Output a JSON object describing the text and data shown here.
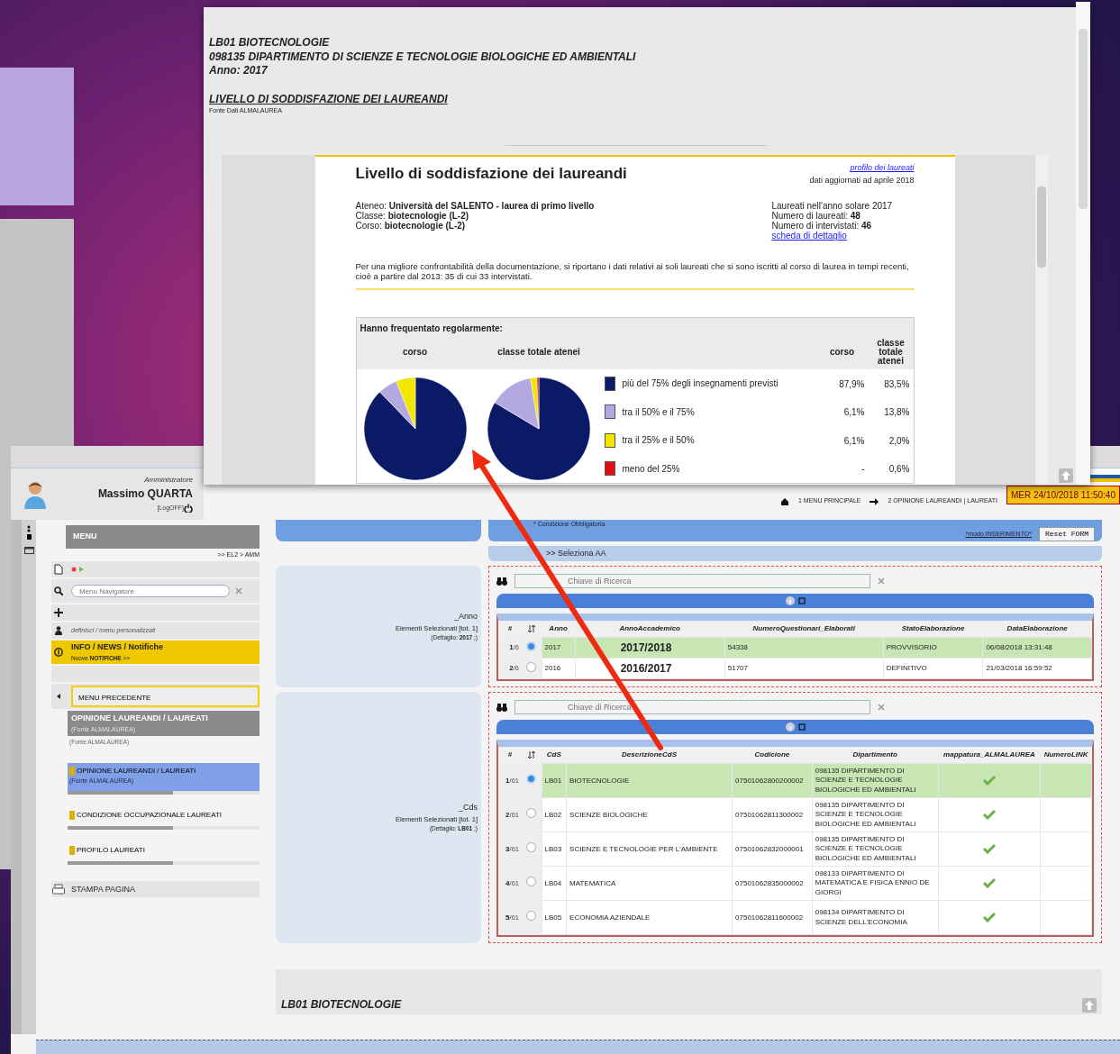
{
  "report": {
    "lines": [
      "LB01 BIOTECNOLOGIE",
      "098135 DIPARTIMENTO DI SCIENZE E TECNOLOGIE BIOLOGICHE ED AMBIENTALI",
      "Anno: 2017"
    ],
    "section_title": "LIVELLO DI SODDISFAZIONE DEI LAUREANDI",
    "source": "Fonte Dati ALMALAUREA",
    "document": {
      "title": "Livello di soddisfazione dei laureandi",
      "profile_link": "profilo dei laureati",
      "updated": "dati aggiornati ad aprile 2018",
      "info_left": [
        "Ateneo: **Università del SALENTO - laurea di primo livello**",
        "Classe: **biotecnologie (L-2)**",
        "Corso: **biotecnologie (L-2)**"
      ],
      "info_right": [
        "Laureati nell'anno solare 2017",
        "Numero di laureati: **48**",
        "Numero di intervistati: **46**"
      ],
      "detail_link": "scheda di dettaglio",
      "note": "Per una migliore confrontabilità della documentazione, si riportano i dati relativi ai soli laureati che si sono iscritti al corso di laurea in tempi recenti, cioè a partire dal 2013: 35 di cui 33 intervistati.",
      "attendance": {
        "title": "Hanno frequentato regolarmente:",
        "value_headers": [
          "corso",
          "classe totale atenei"
        ],
        "rows": [
          {
            "label": "più del 75% degli insegnamenti previsti",
            "color": "#0b1a66",
            "corso": "87,9%",
            "classe": "83,5%"
          },
          {
            "label": "tra il 50% e il 75%",
            "color": "#b4a8e0",
            "corso": "6,1%",
            "classe": "13,8%"
          },
          {
            "label": "tra il 25% e il 50%",
            "color": "#f2e600",
            "corso": "6,1%",
            "classe": "2,0%"
          },
          {
            "label": "meno del 25%",
            "color": "#e01010",
            "corso": "-",
            "classe": "0,6%"
          }
        ],
        "charts": [
          {
            "chart_data": {
              "type": "pie",
              "title": "corso",
              "values": [
                87.9,
                6.1,
                6.1,
                0
              ]
            }
          },
          {
            "chart_data": {
              "type": "pie",
              "title": "classe totale atenei",
              "values": [
                83.5,
                13.8,
                2.0,
                0.6
              ]
            }
          }
        ]
      }
    }
  },
  "app": {
    "user": {
      "role": "Amministratore",
      "name": "Massimo QUARTA",
      "logoff": "[LogOFF]"
    },
    "breadcrumb": [
      "1 MENU PRINCIPALE",
      "2 OPINIONE LAUREANDI | LAUREATI"
    ],
    "clock": "MER 24/10/2018 11:50:40",
    "sidebar": {
      "title": "MENU",
      "path": ">> EL2 > AMM",
      "search_placeholder": "Menu Navigatore",
      "custom_menu": "definisci / menu personalizzati",
      "info": {
        "title": "INFO / NEWS / Notifiche",
        "subtitle": "Nuove **NOTIFICHE** >>"
      },
      "back": "MENU PRECEDENTE",
      "group": {
        "title": "OPINIONE LAUREANDI / LAUREATI",
        "ghost": "(Fonte ALMALAUREA)",
        "source": "(Fonte ALMALAUREA)"
      },
      "items": [
        {
          "label": "OPINIONE LAUREANDI / LAUREATI",
          "sub": "(Fonte ALMALAUREA)",
          "selected": true
        },
        {
          "label": "CONDIZIONE OCCUPAZIONALE LAUREATI",
          "selected": false
        },
        {
          "label": "PROFILO LAUREATI",
          "selected": false
        }
      ],
      "print": "STAMPA PAGINA"
    },
    "form": {
      "required_note": "* Condizione Obbligatoria",
      "mode_link": "*modo INSERIMENTO*",
      "reset": "Reset FORM",
      "section": ">> Seleziona AA",
      "fields": [
        {
          "label": "_Anno",
          "selected_text": "Elementi Selezionati [tot. 1]",
          "detail": "(Dettaglio: **2017** ;)",
          "search_placeholder": "Chiave di Ricerca",
          "number_header": "#",
          "columns": [
            "Anno",
            "AnnoAccademico",
            "NumeroQuestionari_Elaborati",
            "StatoElaborazione",
            "DataElaborazione"
          ],
          "rows": [
            {
              "num": "1",
              "of": "/6",
              "selected": true,
              "cells": [
                "2017",
                "2017/2018",
                "54338",
                "PROVVISORIO",
                "06/08/2018 13:31:48"
              ]
            },
            {
              "num": "2",
              "of": "/6",
              "selected": false,
              "cells": [
                "2016",
                "2016/2017",
                "51707",
                "DEFINITIVO",
                "21/03/2018 16:59:52"
              ]
            }
          ]
        },
        {
          "label": "_Cds",
          "selected_text": "Elementi Selezionati [tot. 1]",
          "detail": "(Dettaglio: **LB01** ;)",
          "search_placeholder": "Chiave di Ricerca",
          "number_header": "#",
          "columns": [
            "CdS",
            "DescrizioneCdS",
            "Codicione",
            "Dipartimento",
            "mappatura_ALMALAUREA",
            "NumeroLINK"
          ],
          "rows": [
            {
              "num": "1",
              "of": "/61",
              "selected": true,
              "mapped": true,
              "cells": [
                "LB01",
                "BIOTECNOLOGIE",
                "07501062800200002",
                "098135 DIPARTIMENTO DI SCIENZE E TECNOLOGIE BIOLOGICHE ED AMBIENTALI"
              ]
            },
            {
              "num": "2",
              "of": "/61",
              "selected": false,
              "mapped": true,
              "cells": [
                "LB02",
                "SCIENZE BIOLOGICHE",
                "07501062811300002",
                "098135 DIPARTIMENTO DI SCIENZE E TECNOLOGIE BIOLOGICHE ED AMBIENTALI"
              ]
            },
            {
              "num": "3",
              "of": "/61",
              "selected": false,
              "mapped": true,
              "cells": [
                "LB03",
                "SCIENZE E TECNOLOGIE PER L'AMBIENTE",
                "07501062832000001",
                "098135 DIPARTIMENTO DI SCIENZE E TECNOLOGIE BIOLOGICHE ED AMBIENTALI"
              ]
            },
            {
              "num": "4",
              "of": "/61",
              "selected": false,
              "mapped": true,
              "cells": [
                "LB04",
                "MATEMATICA",
                "07501062835000002",
                "098133 DIPARTIMENTO DI MATEMATICA E FISICA ENNIO DE GIORGI"
              ]
            },
            {
              "num": "5",
              "of": "/61",
              "selected": false,
              "mapped": true,
              "cells": [
                "LB05",
                "ECONOMIA AZIENDALE",
                "07501062811600002",
                "098134 DIPARTIMENTO DI SCIENZE DELL'ECONOMIA"
              ]
            }
          ]
        }
      ]
    },
    "footer_title": "LB01 BIOTECNOLOGIE"
  }
}
